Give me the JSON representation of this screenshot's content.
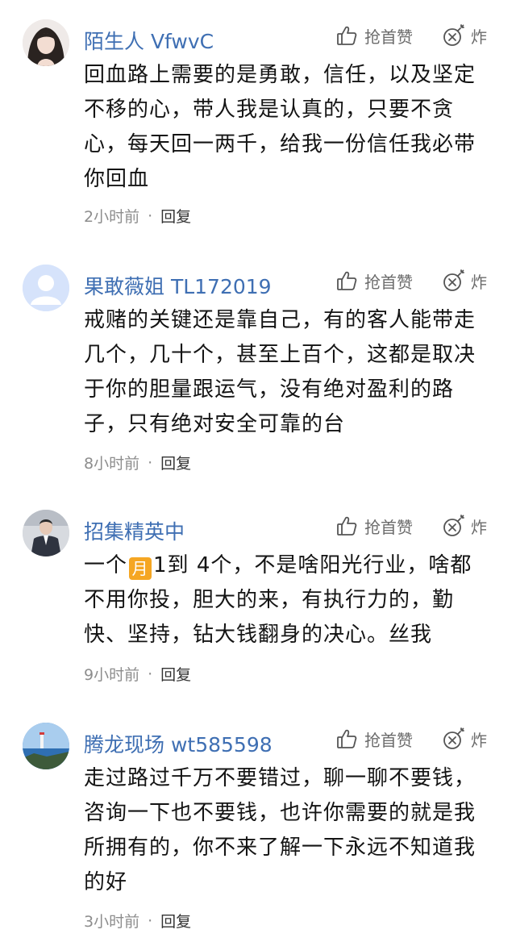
{
  "like_label": "抢首赞",
  "bomb_label": "炸",
  "reply_label": "回复",
  "separator": "·",
  "colors": {
    "username": "#3f6fb3",
    "meta": "#8d8d8d",
    "month_emoji": "#f5a623"
  },
  "comments": [
    {
      "username": "陌生人 VfwvC",
      "text": "回血路上需要的是勇敢，信任，以及坚定不移的心，带人我是认真的，只要不贪心，每天回一两千，给我一份信任我必带你回血",
      "time": "2小时前"
    },
    {
      "username": "果敢薇姐 TL172019",
      "text": "戒赌的关键还是靠自己，有的客人能带走几个，几十个，甚至上百个，这都是取决于你的胆量跟运气，没有绝对盈利的路子，只有绝对安全可靠的台",
      "time": "8小时前"
    },
    {
      "username": "招集精英中",
      "text_before": "一个",
      "emoji_label": "月",
      "text_after": "1到 4个，不是啥阳光行业，啥都不用你投，胆大的来，有执行力的，勤快、坚持，钻大钱翻身的决心。丝我",
      "time": "9小时前"
    },
    {
      "username": "腾龙现场 wt585598",
      "text": "走过路过千万不要错过，聊一聊不要钱，咨询一下也不要钱，也许你需要的就是我所拥有的，你不来了解一下永远不知道我的好",
      "time": "3小时前"
    }
  ]
}
